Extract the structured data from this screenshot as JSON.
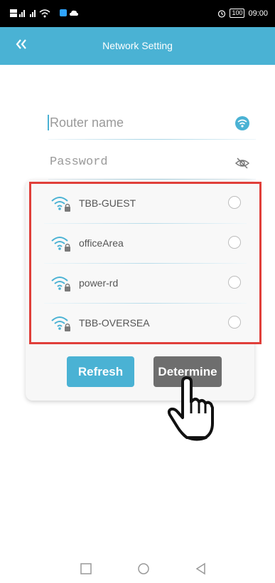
{
  "status_bar": {
    "carrier_left": "HD",
    "time": "09:00",
    "battery": "100",
    "icons": [
      "sim-signal-icon",
      "wifi-status-icon",
      "notification-icon",
      "alarm-icon",
      "battery-icon"
    ]
  },
  "header": {
    "back_icon": "double-chevron-left-icon",
    "title": "Network Setting"
  },
  "form": {
    "router_name_placeholder": "Router name",
    "password_placeholder": "Password",
    "wifi_icon": "wifi-icon",
    "visibility_icon": "eye-hidden-icon"
  },
  "networks": [
    {
      "name": "TBB-GUEST",
      "selected": false
    },
    {
      "name": "officeArea",
      "selected": false
    },
    {
      "name": "power-rd",
      "selected": false
    },
    {
      "name": "TBB-OVERSEA",
      "selected": false
    }
  ],
  "actions": {
    "refresh_label": "Refresh",
    "determine_label": "Determine"
  },
  "nav_bar": {
    "icons": [
      "recents-square-icon",
      "home-circle-icon",
      "back-triangle-icon"
    ]
  },
  "colors": {
    "accent": "#4ab2d4",
    "highlight_border": "#e03f3a",
    "determine_bg": "#6e6e6e"
  }
}
